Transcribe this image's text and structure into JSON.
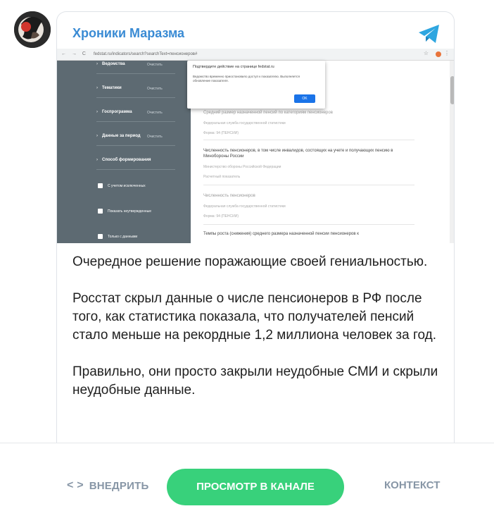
{
  "channel": {
    "name": "Хроники Маразма"
  },
  "embedded_screenshot": {
    "url": "fedstat.ru/indicators/search?searchText=пенсионеров#",
    "sidebar": {
      "rows": [
        "Ведомства",
        "Тематики",
        "Госпрограмма",
        "Данные за период",
        "Способ формирования"
      ],
      "clear_label": "Очистить",
      "checkboxes": [
        "С учетом исключенных",
        "Показать неутвержденные",
        "Только с данными"
      ]
    },
    "dialog": {
      "title": "Подтвердите действие на странице fedstat.ru",
      "text": "Ведомство временно приостановило доступ к показателю. Выполняется обновление показателя.",
      "ok": "OK"
    },
    "results": [
      {
        "title": "Средний размер назначенной пенсий по категориям пенсионеров",
        "source": "Федеральная служба государственной статистики",
        "form": "Форма: 94 (ПЕНСИИ)",
        "muted": true
      },
      {
        "title": "Численность пенсионеров, в том числе инвалидов, состоящих на учете и получающих пенсию в Минобороны России",
        "source": "Министерство обороны Российской Федерации",
        "form": "Расчетный показатель",
        "muted": false
      },
      {
        "title": "Численность пенсионеров",
        "source": "Федеральная служба государственной статистики",
        "form": "Форма: 94 (ПЕНСИИ)",
        "muted": true
      },
      {
        "title": "Темпы роста (снижения) среднего размера назначенной пенсии пенсионеров к",
        "source": "",
        "form": "",
        "muted": false
      }
    ]
  },
  "post": {
    "paragraphs": [
      "Очередное решение поражающие своей гениальностью.",
      "Росстат скрыл данные о числе пенсионеров в РФ после того, как статистика показала, что получателей пенсий стало меньше на рекордные 1,2 миллиона человек за год.",
      "Правильно, они просто закрыли неудобные СМИ и скрыли неудобные данные."
    ]
  },
  "footer": {
    "embed_label": "ВНЕДРИТЬ",
    "view_label": "ПРОСМОТР В КАНАЛЕ",
    "context_label": "КОНТЕКСТ"
  },
  "colors": {
    "accent": "#3a8bd4",
    "view_button": "#38d17b",
    "muted": "#8796a6"
  },
  "icons": {
    "telegram": "telegram-icon",
    "embed": "code-brackets-icon"
  }
}
